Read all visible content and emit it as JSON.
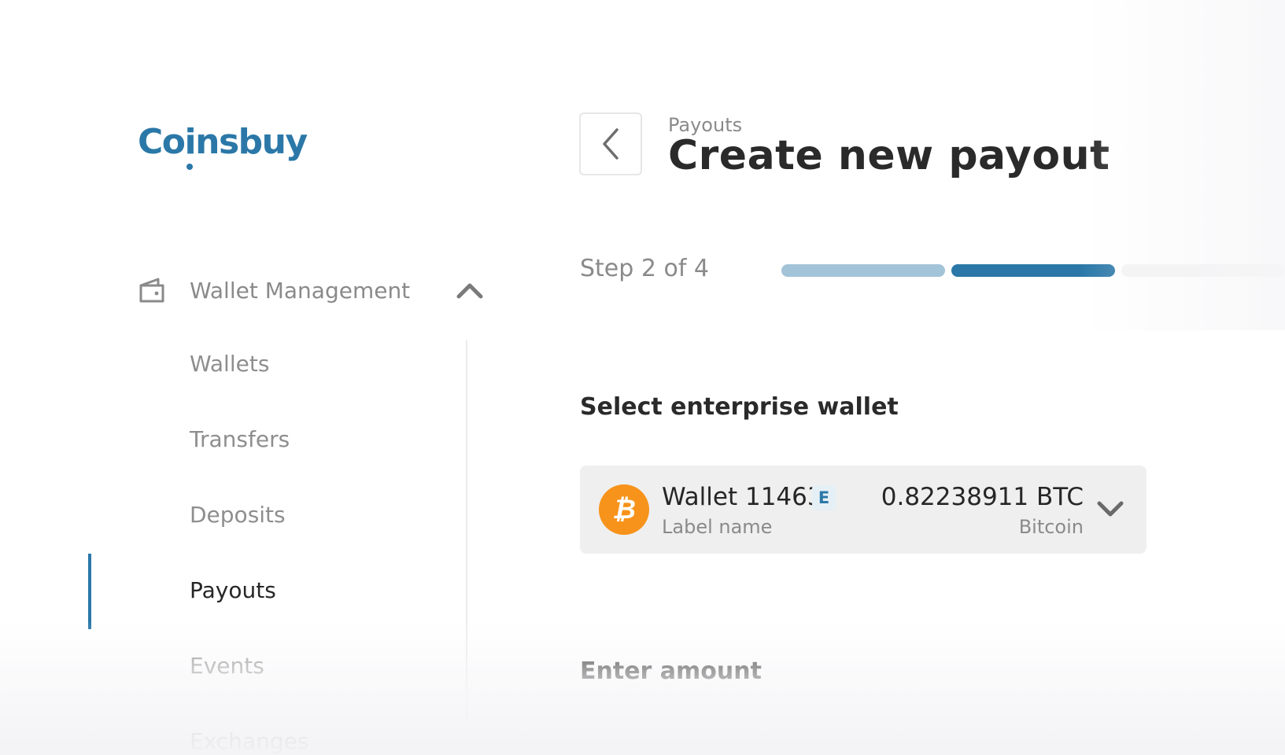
{
  "brand": {
    "logo_text_before": "Co",
    "logo_text_i": "i",
    "logo_text_after": "nsbuy",
    "color": "#2b78a8"
  },
  "sidebar": {
    "group": {
      "label": "Wallet Management",
      "icon": "wallet-icon",
      "expanded": true
    },
    "items": [
      {
        "label": "Wallets",
        "active": false
      },
      {
        "label": "Transfers",
        "active": false
      },
      {
        "label": "Deposits",
        "active": false
      },
      {
        "label": "Payouts",
        "active": true
      },
      {
        "label": "Events",
        "active": false
      },
      {
        "label": "Exchanges",
        "active": false
      }
    ]
  },
  "header": {
    "breadcrumb": "Payouts",
    "title": "Create new payout",
    "back_icon": "chevron-left-icon"
  },
  "steps": {
    "label": "Step 2 of 4",
    "current": 2,
    "total": 4,
    "colors": {
      "done": "#a3c3d8",
      "current": "#2b78a8",
      "todo": "#f3f3f3"
    }
  },
  "form": {
    "wallet_section_label": "Select enterprise wallet",
    "wallet": {
      "name": "Wallet 11463",
      "badge": "E",
      "label": "Label name",
      "amount": "0.82238911 BTC",
      "coin_name": "Bitcoin",
      "coin_symbol": "₿",
      "coin_color": "#f7931a"
    },
    "amount_section_label": "Enter amount"
  }
}
